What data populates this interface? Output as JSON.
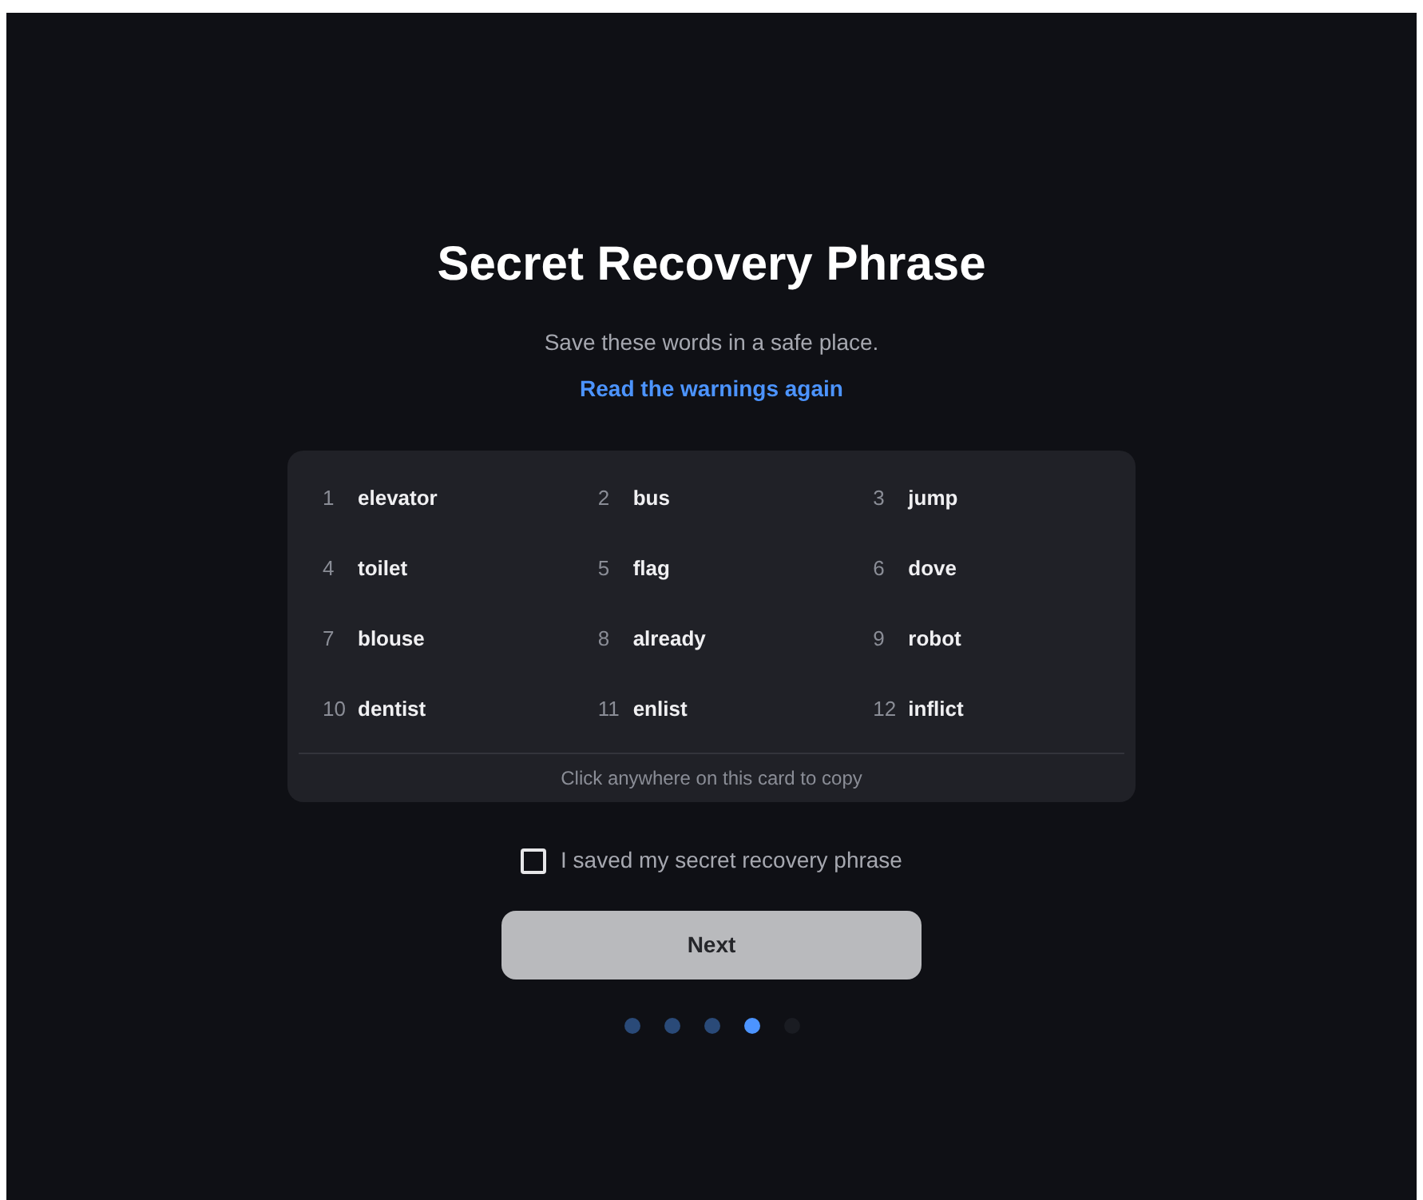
{
  "title": "Secret Recovery Phrase",
  "subtitle": "Save these words in a safe place.",
  "link": "Read the warnings again",
  "words": [
    {
      "index": "1",
      "word": "elevator"
    },
    {
      "index": "2",
      "word": "bus"
    },
    {
      "index": "3",
      "word": "jump"
    },
    {
      "index": "4",
      "word": "toilet"
    },
    {
      "index": "5",
      "word": "flag"
    },
    {
      "index": "6",
      "word": "dove"
    },
    {
      "index": "7",
      "word": "blouse"
    },
    {
      "index": "8",
      "word": "already"
    },
    {
      "index": "9",
      "word": "robot"
    },
    {
      "index": "10",
      "word": "dentist"
    },
    {
      "index": "11",
      "word": "enlist"
    },
    {
      "index": "12",
      "word": "inflict"
    }
  ],
  "card_hint": "Click anywhere on this card to copy",
  "confirm": {
    "label": "I saved my secret recovery phrase",
    "checked": false
  },
  "next_button": {
    "label": "Next",
    "disabled": true
  },
  "steps": [
    {
      "kind": "done"
    },
    {
      "kind": "done"
    },
    {
      "kind": "done"
    },
    {
      "kind": "current"
    },
    {
      "kind": "pending"
    }
  ]
}
